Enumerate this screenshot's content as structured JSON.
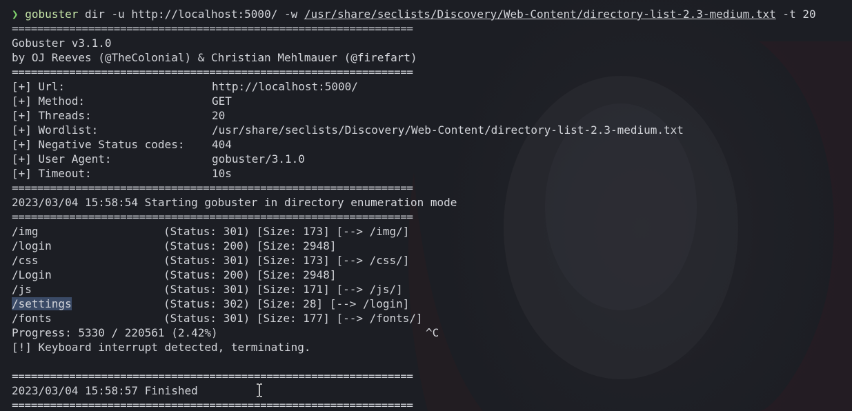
{
  "command": {
    "prompt_symbol": "❯",
    "program": "gobuster",
    "args": " dir -u http://localhost:5000/ -w ",
    "wordlist_path": "/usr/share/seclists/Discovery/Web-Content/directory-list-2.3-medium.txt",
    "trailing_args": " -t 20"
  },
  "separator": "===============================================================",
  "banner": {
    "version": "Gobuster v3.1.0",
    "authors": "by OJ Reeves (@TheColonial) & Christian Mehlmauer (@firefart)"
  },
  "config": [
    {
      "key": "[+] Url:",
      "value": "http://localhost:5000/"
    },
    {
      "key": "[+] Method:",
      "value": "GET"
    },
    {
      "key": "[+] Threads:",
      "value": "20"
    },
    {
      "key": "[+] Wordlist:",
      "value": "/usr/share/seclists/Discovery/Web-Content/directory-list-2.3-medium.txt"
    },
    {
      "key": "[+] Negative Status codes:",
      "value": "404"
    },
    {
      "key": "[+] User Agent:",
      "value": "gobuster/3.1.0"
    },
    {
      "key": "[+] Timeout:",
      "value": "10s"
    }
  ],
  "start_message": "2023/03/04 15:58:54 Starting gobuster in directory enumeration mode",
  "results": [
    {
      "path": "/img",
      "info": "(Status: 301) [Size: 173] [--> /img/]"
    },
    {
      "path": "/login",
      "info": "(Status: 200) [Size: 2948]"
    },
    {
      "path": "/css",
      "info": "(Status: 301) [Size: 173] [--> /css/]"
    },
    {
      "path": "/Login",
      "info": "(Status: 200) [Size: 2948]"
    },
    {
      "path": "/js",
      "info": "(Status: 301) [Size: 171] [--> /js/]"
    },
    {
      "path": "/settings",
      "info": "(Status: 302) [Size: 28] [--> /login]"
    },
    {
      "path": "/fonts",
      "info": "(Status: 301) [Size: 177] [--> /fonts/]"
    }
  ],
  "progress": {
    "text": "Progress: 5330 / 220561 (2.42%)",
    "interrupt": "^C"
  },
  "interrupt_message": "[!] Keyboard interrupt detected, terminating.",
  "finish_message": "2023/03/04 15:58:57 Finished",
  "colors": {
    "background": "#1c1e24",
    "text": "#d3d5da",
    "prompt_arrow": "#7fd16c",
    "command": "#c7e7a9",
    "selection": "#3a4a66"
  }
}
